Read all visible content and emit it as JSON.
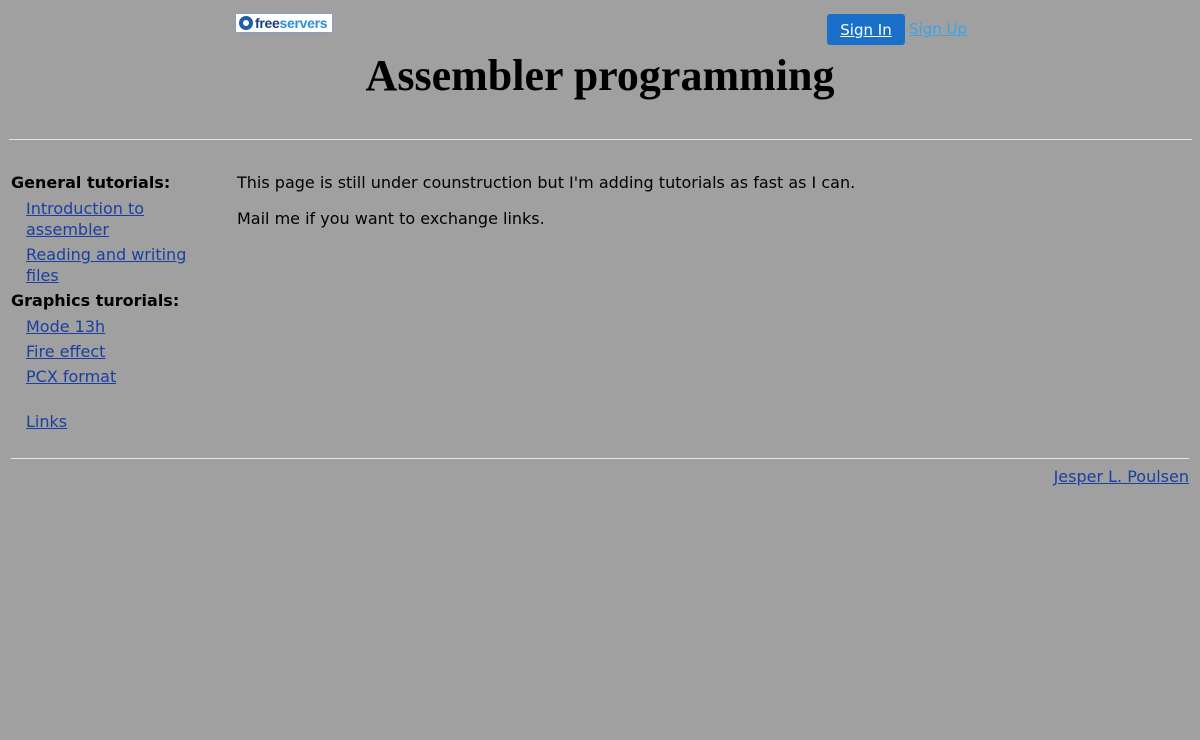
{
  "header": {
    "logo": {
      "free": "free",
      "servers": "servers"
    },
    "sign_in_label": "Sign In",
    "sign_up_label": "Sign Up"
  },
  "page_title": "Assembler programming",
  "sidebar": {
    "general_heading": "General tutorials:",
    "general_items": [
      "Introduction to assembler",
      "Reading and writing files"
    ],
    "graphics_heading": "Graphics turorials:",
    "graphics_items": [
      "Mode 13h",
      "Fire effect",
      "PCX format"
    ],
    "links_label": "Links"
  },
  "main": {
    "paragraphs": [
      "This page is still under counstruction but I'm adding tutorials as fast as I can.",
      "Mail me if you want to exchange links."
    ]
  },
  "footer": {
    "author": "Jesper L. Poulsen"
  },
  "colors": {
    "background": "#a0a0a0",
    "link": "#1a3fa0",
    "sign_in_bg": "#1a6fc9",
    "sign_up": "#3aa4e6"
  }
}
